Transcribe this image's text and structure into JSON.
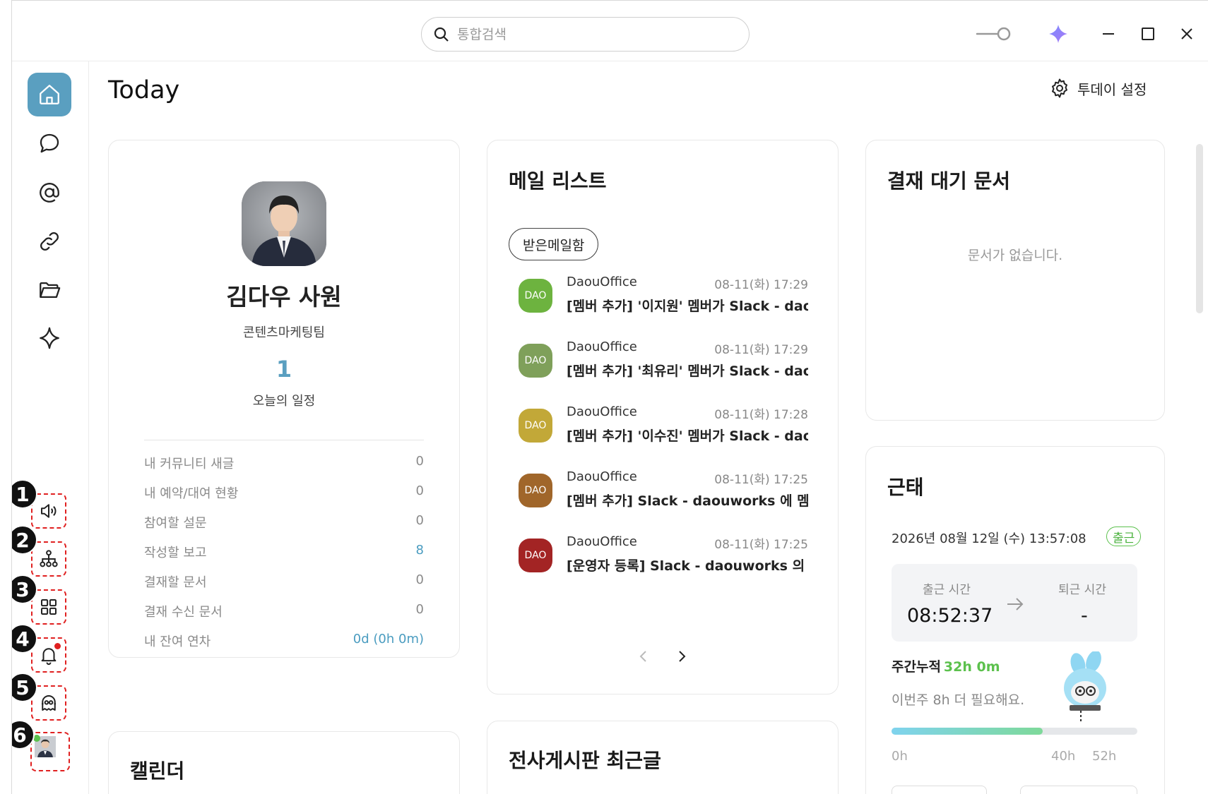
{
  "search": {
    "placeholder": "통합검색"
  },
  "page": {
    "title": "Today",
    "settings_label": "투데이 설정"
  },
  "sidebar": {
    "nav": [
      {
        "name": "home",
        "icon": "home-icon",
        "active": true
      },
      {
        "name": "chat",
        "icon": "chat-icon"
      },
      {
        "name": "mail",
        "icon": "at-icon"
      },
      {
        "name": "link",
        "icon": "link-icon"
      },
      {
        "name": "folder",
        "icon": "folder-icon"
      },
      {
        "name": "ai",
        "icon": "sparkle-icon"
      }
    ],
    "tools": [
      {
        "marker": "1",
        "icon": "speaker-icon"
      },
      {
        "marker": "2",
        "icon": "org-chart-icon"
      },
      {
        "marker": "3",
        "icon": "apps-grid-icon"
      },
      {
        "marker": "4",
        "icon": "bell-icon",
        "has_alert": true
      },
      {
        "marker": "5",
        "icon": "mascot-icon"
      },
      {
        "marker": "6",
        "icon": "avatar-icon",
        "online": true
      }
    ]
  },
  "profile": {
    "name": "김다우 사원",
    "team": "콘텐츠마케팅팀",
    "today_count": "1",
    "today_label": "오늘의 일정",
    "stats": [
      {
        "label": "내 커뮤니티 새글",
        "value": "0",
        "highlight": false
      },
      {
        "label": "내 예약/대여 현황",
        "value": "0",
        "highlight": false
      },
      {
        "label": "참여할 설문",
        "value": "0",
        "highlight": false
      },
      {
        "label": "작성할 보고",
        "value": "8",
        "highlight": true
      },
      {
        "label": "결재할 문서",
        "value": "0",
        "highlight": false
      },
      {
        "label": "결재 수신 문서",
        "value": "0",
        "highlight": false
      },
      {
        "label": "내 잔여 연차",
        "value": "0d (0h 0m)",
        "highlight": true
      }
    ]
  },
  "mail": {
    "title": "메일 리스트",
    "folder_label": "받은메일함",
    "items": [
      {
        "badge": "DAO",
        "badge_color": "#6db33f",
        "sender": "DaouOffice",
        "date": "08-11(화) 17:29",
        "subject": "[멤버 추가] '이지원' 멤버가 Slack - daouworks 에 참여했습니다"
      },
      {
        "badge": "DAO",
        "badge_color": "#7fa05a",
        "sender": "DaouOffice",
        "date": "08-11(화) 17:29",
        "subject": "[멤버 추가] '최유리' 멤버가 Slack - daouworks 에 참여했습니다"
      },
      {
        "badge": "DAO",
        "badge_color": "#c2a838",
        "sender": "DaouOffice",
        "date": "08-11(화) 17:28",
        "subject": "[멤버 추가] '이수진' 멤버가 Slack - daouworks 에 참여했습니다"
      },
      {
        "badge": "DAO",
        "badge_color": "#a0662a",
        "sender": "DaouOffice",
        "date": "08-11(화) 17:25",
        "subject": "[멤버 추가] Slack - daouworks 에 멤버가 추가되었습니다"
      },
      {
        "badge": "DAO",
        "badge_color": "#a32424",
        "sender": "DaouOffice",
        "date": "08-11(화) 17:25",
        "subject": "[운영자 등록] Slack - daouworks 의 운영자로 등록되었습니다"
      }
    ]
  },
  "approval": {
    "title": "결재 대기 문서",
    "empty": "문서가 없습니다."
  },
  "attendance": {
    "title": "근태",
    "datetime": "2026년 08월 12일 (수) 13:57:08",
    "status": "출근",
    "checkin_label": "출근 시간",
    "checkin_value": "08:52:37",
    "checkout_label": "퇴근 시간",
    "checkout_value": "-",
    "weekly_label": "주간누적",
    "weekly_value": "32h 0m",
    "need_text": "이번주 8h 더 필요해요.",
    "progress": {
      "value_hours": 32,
      "max_hours": 52
    },
    "ticks": [
      "0h",
      "40h",
      "52h"
    ]
  },
  "calendar": {
    "title": "캘린더"
  },
  "board": {
    "title": "전사게시판 최근글"
  },
  "colors": {
    "accent": "#5a9fc0",
    "green": "#5cc14d",
    "marker": "#e02020"
  }
}
